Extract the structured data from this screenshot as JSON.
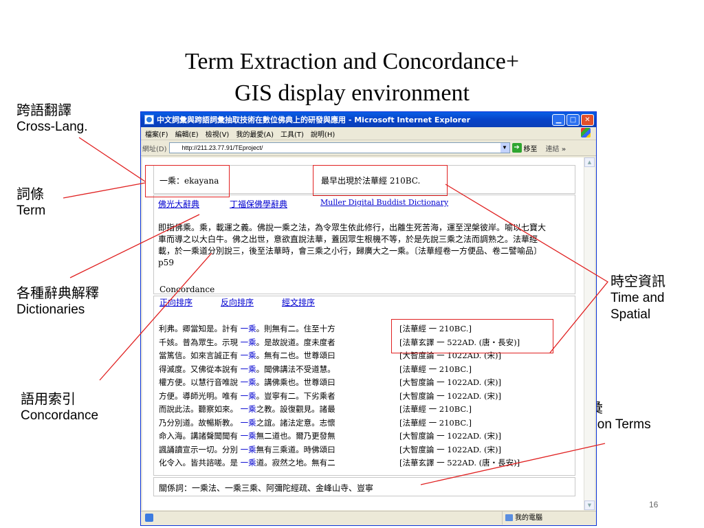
{
  "slide": {
    "title_line1": "Term Extraction and Concordance+",
    "title_line2": "GIS display environment",
    "page_number": "16"
  },
  "annotations": {
    "cross_lang": {
      "zh": "跨語翻譯",
      "en": "Cross-Lang."
    },
    "term": {
      "zh": "詞條",
      "en": "Term"
    },
    "dictionaries": {
      "zh": "各種辭典解釋",
      "en": "Dictionaries"
    },
    "concordance": {
      "zh": "語用索引",
      "en": "Concordance"
    },
    "spatial": {
      "zh": "時空資訊",
      "en_line1": "Time and",
      "en_line2": "Spatial"
    },
    "correlation": {
      "zh": "相關詞彙",
      "en": "Correlation Terms"
    }
  },
  "browser": {
    "title": "中文詞彙與跨語詞彙抽取技術在數位佛典上的研發與應用 - Microsoft Internet Explorer",
    "menu": [
      "檔案(F)",
      "編輯(E)",
      "檢視(V)",
      "我的最愛(A)",
      "工具(T)",
      "說明(H)"
    ],
    "address_label": "網址(D)",
    "address_value": "http://211.23.77.91/TEproject/",
    "go_label": "移至",
    "links_label": "連結",
    "more": "»",
    "status_zone": "我的電腦"
  },
  "page": {
    "term_label": "一乘：ekayana",
    "first_appearance": "最早出現於法華經 210BC.",
    "dictionaries": [
      "佛光大辭典",
      "丁福保佛學辭典",
      "Muller Digital Buddist Dictionary"
    ],
    "definition": "即指佛乘。乘，載運之義。佛說一乘之法，為令眾生依此修行，出離生死苦海，運至涅槃彼岸。喻以七寶大車而導之以大白牛。佛之出世，意欲直說法華，蓋因眾生根機不等，於是先說三乘之法而調熟之。法華經載，於一乘道分別說三，後至法華時，會三乘之小行，歸廣大之一乘。〔法華經卷一方便品、卷二譬喻品〕 p59",
    "concordance_label": "Concordance",
    "sort_links": [
      "正向排序",
      "反向排序",
      "經文排序"
    ],
    "concordance_rows": [
      {
        "left": "利弗。卿當知是。計有",
        "kw": "一乘",
        "right": "。則無有二。住至十方",
        "source": "[法華經 一 210BC.]"
      },
      {
        "left": "千姟。普為眾生。示現",
        "kw": "一乘",
        "right": "。是故說道。度未度者",
        "source": "[法華玄譯 一 522AD. (唐・長安)]"
      },
      {
        "left": "當篤信。如來言誠正有",
        "kw": "一乘",
        "right": "。無有二也。世尊頌曰",
        "source": "[大智度論 一 1022AD. (宋)]"
      },
      {
        "left": "得滅度。又佛從本說有",
        "kw": "一乘",
        "right": "。聞佛講法不受道慧。",
        "source": "[法華經 一 210BC.]"
      },
      {
        "left": "權方便。以慧行音唯說",
        "kw": "一乘",
        "right": "。講佛乘也。世尊頌曰",
        "source": "[大智度論 一 1022AD. (宋)]"
      },
      {
        "left": "方便。導師光明。唯有",
        "kw": "一乘",
        "right": "。豈寧有二。下劣乘者",
        "source": "[大智度論 一 1022AD. (宋)]"
      },
      {
        "left": "而說此法。聽察如來。",
        "kw": "一乘",
        "right": "之教。設復觀見。諸最",
        "source": "[法華經 一 210BC.]"
      },
      {
        "left": "乃分別道。故暢斯教。",
        "kw": "一乘",
        "right": "之誼。諸法定意。志懷",
        "source": "[法華經 一 210BC.]"
      },
      {
        "left": "命入海。講諸聲聞聞有",
        "kw": "一乘",
        "right": "無二道也。爾乃更發無",
        "source": "[大智度論 一 1022AD. (宋)]"
      },
      {
        "left": "諷誦讀宣示一切。分別",
        "kw": "一乘",
        "right": "無有三乘道。時佛頌曰",
        "source": "[大智度論 一 1022AD. (宋)]"
      },
      {
        "left": "化令入。皆共諮嗟。是",
        "kw": "一乘",
        "right": "道。寂然之地。無有二",
        "source": "[法華玄譯 一 522AD. (唐・長安)]"
      }
    ],
    "related_terms": "關係詞：一乘法、一乘三乘、阿彌陀經疏、金峰山寺、豈寧"
  },
  "colors": {
    "highlight_box": "#e02020",
    "link": "#0000d0",
    "xp_title": "#0a4fd5"
  }
}
